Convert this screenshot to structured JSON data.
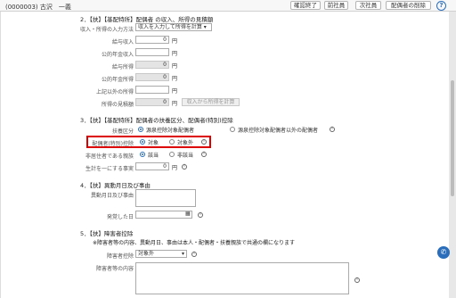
{
  "header": {
    "employee": "(0000003) 古沢　一義",
    "buttons": [
      "確認終了",
      "前社員",
      "次社員",
      "配偶者の削除"
    ],
    "help": "?"
  },
  "sec2": {
    "title": "2．【扶】【基配特所】配偶者 の収入、所得の見積額",
    "method_label": "収入・所得の入力方法",
    "method_value": "収入を入力して所得を計算",
    "salary_income_label": "給与収入",
    "salary_income_value": "0",
    "pension_income_label": "公的年金収入",
    "salary_earnings_label": "給与所得",
    "salary_earnings_value": "0",
    "pension_earnings_label": "公的年金所得",
    "pension_earnings_value": "0",
    "other_earnings_label": "上記以外の所得",
    "estimated_label": "所得の見積額",
    "estimated_value": "0",
    "calc_button": "収入から所得を計算",
    "unit": "円"
  },
  "sec3": {
    "title": "3．【扶】【基配特所】配偶者の扶養区分、配偶者(特別)控除",
    "dependent_label": "扶養区分",
    "dependent_opt1": "源泉控除対象配偶者",
    "dependent_opt2": "源泉控除対象配偶者以外の配偶者",
    "special_label": "配偶者(特別)控除",
    "special_opt1": "対象",
    "special_opt2": "対象外",
    "nonres_label": "非居住者である親族",
    "nonres_opt1": "該当",
    "nonres_opt2": "非該当",
    "living_label": "生計を一にする事実",
    "living_value": "0",
    "unit": "円"
  },
  "sec4": {
    "title": "4．【扶】異動月日及び事由",
    "reason_label": "異動月日及び事由",
    "date_label": "発覚した日"
  },
  "sec5": {
    "title": "5．【扶】障害者控除",
    "note": "※障害者等の内容、異動月日、事由は本人・配偶者・扶養親族で共通の欄になります",
    "deduction_label": "障害者控除",
    "deduction_value": "対象外",
    "content_label": "障害者等の内容"
  },
  "icons": {
    "info": "info-icon",
    "calendar": "calendar-icon",
    "fab": "chat-support-icon"
  }
}
